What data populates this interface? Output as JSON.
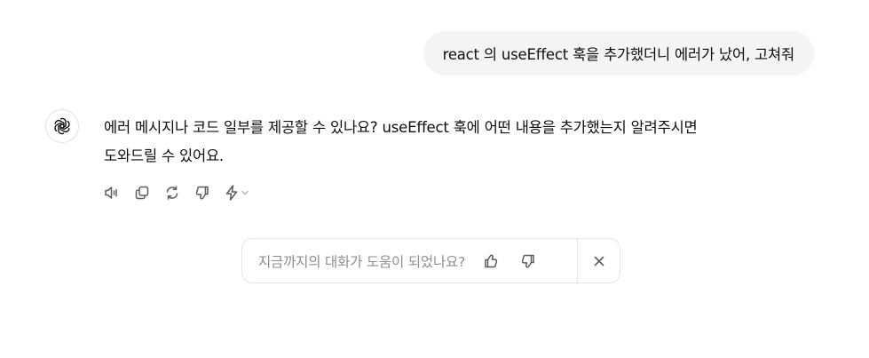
{
  "user_message": {
    "text": "react 의 useEffect 훅을 추가했더니 에러가 났어, 고쳐줘"
  },
  "assistant_message": {
    "avatar_icon": "openai-logo-icon",
    "lines": [
      "에러 메시지나 코드 일부를 제공할 수 있나요? useEffect 훅에 어떤 내용을 추가했는지 알려주시면",
      "도와드릴 수 있어요."
    ],
    "actions": [
      {
        "name": "read-aloud-button",
        "icon": "speaker-icon"
      },
      {
        "name": "copy-button",
        "icon": "copy-icon"
      },
      {
        "name": "regenerate-button",
        "icon": "refresh-icon"
      },
      {
        "name": "thumbs-down-button",
        "icon": "thumbs-down-icon"
      },
      {
        "name": "model-switch-button",
        "icon": "lightning-icon"
      }
    ]
  },
  "feedback": {
    "question": "지금까지의 대화가 도움이 되었나요?",
    "icons": [
      "thumbs-up-icon",
      "thumbs-down-icon",
      "close-icon"
    ]
  },
  "colors": {
    "user_bubble_bg": "#f4f4f4",
    "text": "#0d0d0d",
    "icon": "#5d5d5d",
    "muted_text": "#8f8f8f",
    "border": "#e5e5e5"
  }
}
